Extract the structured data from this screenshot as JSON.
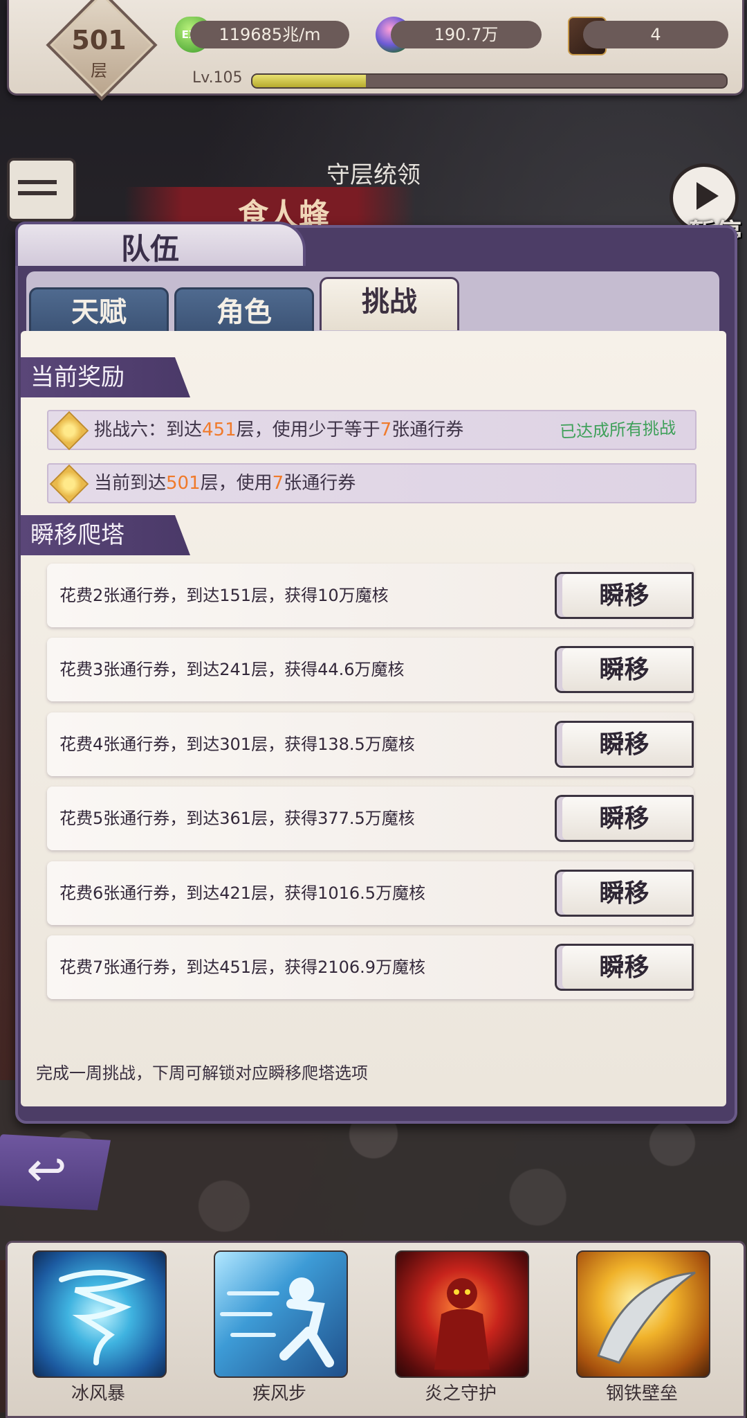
{
  "hud": {
    "floor": "501",
    "floor_unit": "层",
    "exp_icon_text": "EXP",
    "exp_rate": "119685兆/m",
    "magic_core": "190.7万",
    "tickets": "4",
    "level": "Lv.105",
    "level_progress": 0.24,
    "icons": [
      "exp-icon",
      "magic-orb-icon",
      "spellbook-icon"
    ]
  },
  "scene": {
    "boss_title": "守层统领",
    "boss_name": "食人蜂",
    "pause_label": "暂停"
  },
  "panel": {
    "title": "队伍",
    "tabs": [
      {
        "label": "天赋",
        "active": false
      },
      {
        "label": "角色",
        "active": false
      },
      {
        "label": "挑战",
        "active": true
      }
    ]
  },
  "current_reward": {
    "header": "当前奖励",
    "rows": [
      {
        "pre": "挑战六：到达",
        "floor": "451",
        "mid": "层，使用少于等于",
        "count": "7",
        "post": "张通行券",
        "status": "已达成所有挑战"
      },
      {
        "pre": "当前到达",
        "floor": "501",
        "mid": "层，使用",
        "count": "7",
        "post": "张通行券",
        "status": ""
      }
    ]
  },
  "teleport": {
    "header": "瞬移爬塔",
    "button_label": "瞬移",
    "rows": [
      "花费2张通行券，到达151层，获得10万魔核",
      "花费3张通行券，到达241层，获得44.6万魔核",
      "花费4张通行券，到达301层，获得138.5万魔核",
      "花费5张通行券，到达361层，获得377.5万魔核",
      "花费6张通行券，到达421层，获得1016.5万魔核",
      "花费7张通行券，到达451层，获得2106.9万魔核"
    ],
    "footnote": "完成一周挑战，下周可解锁对应瞬移爬塔选项"
  },
  "skills": [
    {
      "name": "冰风暴",
      "icon": "tornado-icon"
    },
    {
      "name": "疾风步",
      "icon": "dash-icon"
    },
    {
      "name": "炎之守护",
      "icon": "flame-guard-icon"
    },
    {
      "name": "钢铁壁垒",
      "icon": "blade-icon"
    }
  ],
  "colors": {
    "accent_purple": "#4c3d66",
    "highlight_orange": "#f07a2a",
    "status_green": "#3fa05a",
    "tab_blue": "#4f6a8f"
  }
}
